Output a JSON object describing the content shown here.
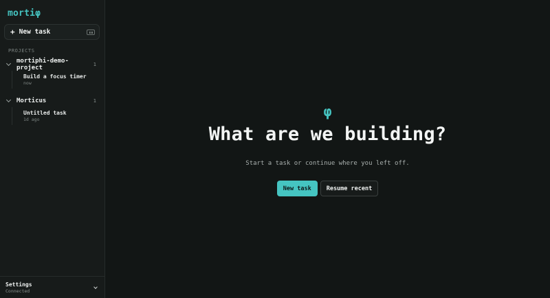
{
  "sidebar": {
    "logo": "mortiφ",
    "new_task_label": "New task",
    "new_task_plus": "+",
    "section_title": "PROJECTS",
    "projects": [
      {
        "name": "mortiphi-demo-project",
        "count": "1",
        "tasks": [
          {
            "title": "Build a focus timer",
            "time": "now"
          }
        ]
      },
      {
        "name": "Morticus",
        "count": "1",
        "tasks": [
          {
            "title": "Untitled task",
            "time": "1d ago"
          }
        ]
      }
    ],
    "footer": {
      "title": "Settings",
      "status": "Connected"
    }
  },
  "main": {
    "symbol": "φ",
    "headline": "What are we building?",
    "subline": "Start a task or continue where you left off.",
    "primary_button": "New task",
    "secondary_button": "Resume recent"
  },
  "colors": {
    "accent": "#45c4c1",
    "background": "#121615",
    "sidebar": "#171b1a"
  }
}
